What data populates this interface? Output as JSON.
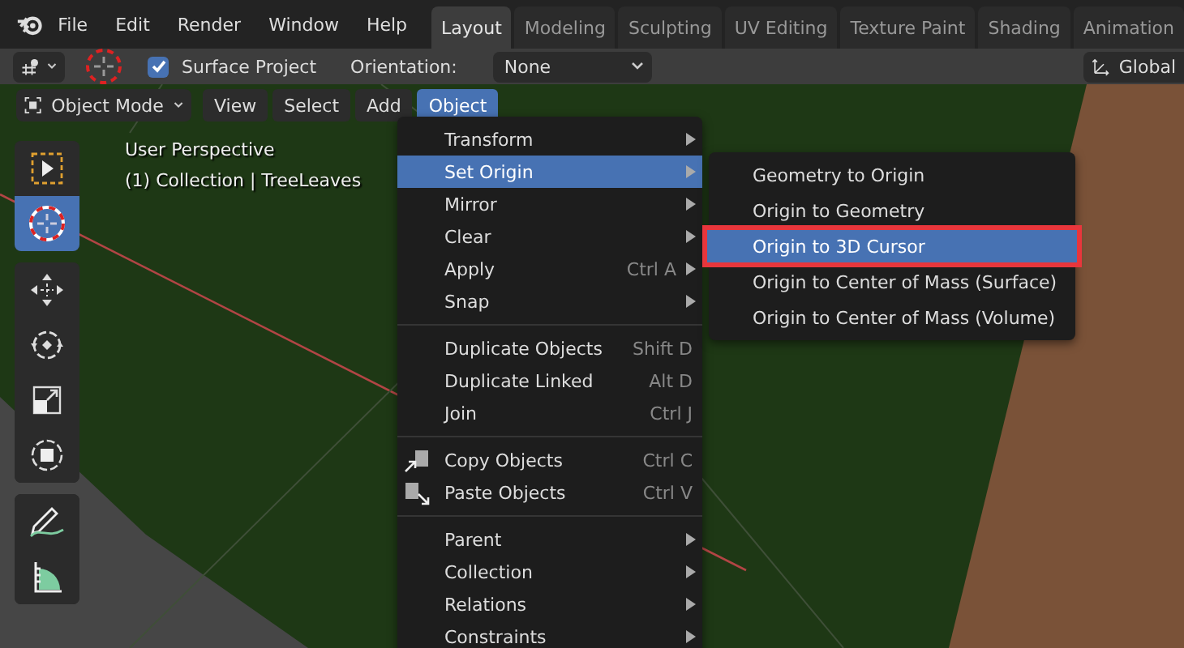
{
  "app_menu": [
    "File",
    "Edit",
    "Render",
    "Window",
    "Help"
  ],
  "workspace_tabs": [
    {
      "label": "Layout",
      "selected": true
    },
    {
      "label": "Modeling",
      "selected": false
    },
    {
      "label": "Sculpting",
      "selected": false
    },
    {
      "label": "UV Editing",
      "selected": false
    },
    {
      "label": "Texture Paint",
      "selected": false
    },
    {
      "label": "Shading",
      "selected": false
    },
    {
      "label": "Animation",
      "selected": false
    }
  ],
  "tool_header": {
    "surface_project": {
      "label": "Surface Project",
      "checked": true
    },
    "orientation_label": "Orientation:",
    "orientation_value": "None",
    "transform_orientation": "Global"
  },
  "viewport_header": {
    "mode": "Object Mode",
    "menus": [
      {
        "label": "View",
        "selected": false
      },
      {
        "label": "Select",
        "selected": false
      },
      {
        "label": "Add",
        "selected": false
      },
      {
        "label": "Object",
        "selected": true
      }
    ]
  },
  "viewport_info": [
    "User Perspective",
    "(1) Collection | TreeLeaves"
  ],
  "toolbar": [
    [
      {
        "kind": "select_box",
        "selected": false
      },
      {
        "kind": "cursor",
        "selected": true
      }
    ],
    [
      {
        "kind": "move",
        "selected": false
      },
      {
        "kind": "rotate",
        "selected": false
      },
      {
        "kind": "scale",
        "selected": false
      },
      {
        "kind": "transform",
        "selected": false
      }
    ],
    [
      {
        "kind": "annotate",
        "selected": false
      },
      {
        "kind": "measure",
        "selected": false
      }
    ]
  ],
  "object_menu": {
    "sections": [
      [
        {
          "label": "Transform",
          "submenu": true,
          "selected": false
        },
        {
          "label": "Set Origin",
          "submenu": true,
          "selected": true
        },
        {
          "label": "Mirror",
          "submenu": true,
          "selected": false
        },
        {
          "label": "Clear",
          "submenu": true,
          "selected": false
        },
        {
          "label": "Apply",
          "shortcut": "Ctrl A",
          "submenu": true,
          "selected": false
        },
        {
          "label": "Snap",
          "submenu": true,
          "selected": false
        }
      ],
      [
        {
          "label": "Duplicate Objects",
          "shortcut": "Shift D",
          "submenu": false,
          "selected": false
        },
        {
          "label": "Duplicate Linked",
          "shortcut": "Alt D",
          "submenu": false,
          "selected": false
        },
        {
          "label": "Join",
          "shortcut": "Ctrl J",
          "submenu": false,
          "selected": false
        }
      ],
      [
        {
          "label": "Copy Objects",
          "shortcut": "Ctrl C",
          "kind": "copy",
          "submenu": false,
          "selected": false
        },
        {
          "label": "Paste Objects",
          "shortcut": "Ctrl V",
          "kind": "paste",
          "submenu": false,
          "selected": false
        }
      ],
      [
        {
          "label": "Parent",
          "submenu": true,
          "selected": false
        },
        {
          "label": "Collection",
          "submenu": true,
          "selected": false
        },
        {
          "label": "Relations",
          "submenu": true,
          "selected": false
        },
        {
          "label": "Constraints",
          "submenu": true,
          "selected": false
        }
      ]
    ]
  },
  "set_origin_menu": {
    "items": [
      {
        "label": "Geometry to Origin",
        "selected": false,
        "outlined": false
      },
      {
        "label": "Origin to Geometry",
        "selected": false,
        "outlined": false
      },
      {
        "label": "Origin to 3D Cursor",
        "selected": true,
        "outlined": true
      },
      {
        "label": "Origin to Center of Mass (Surface)",
        "selected": false,
        "outlined": false
      },
      {
        "label": "Origin to Center of Mass (Volume)",
        "selected": false,
        "outlined": false
      }
    ]
  }
}
